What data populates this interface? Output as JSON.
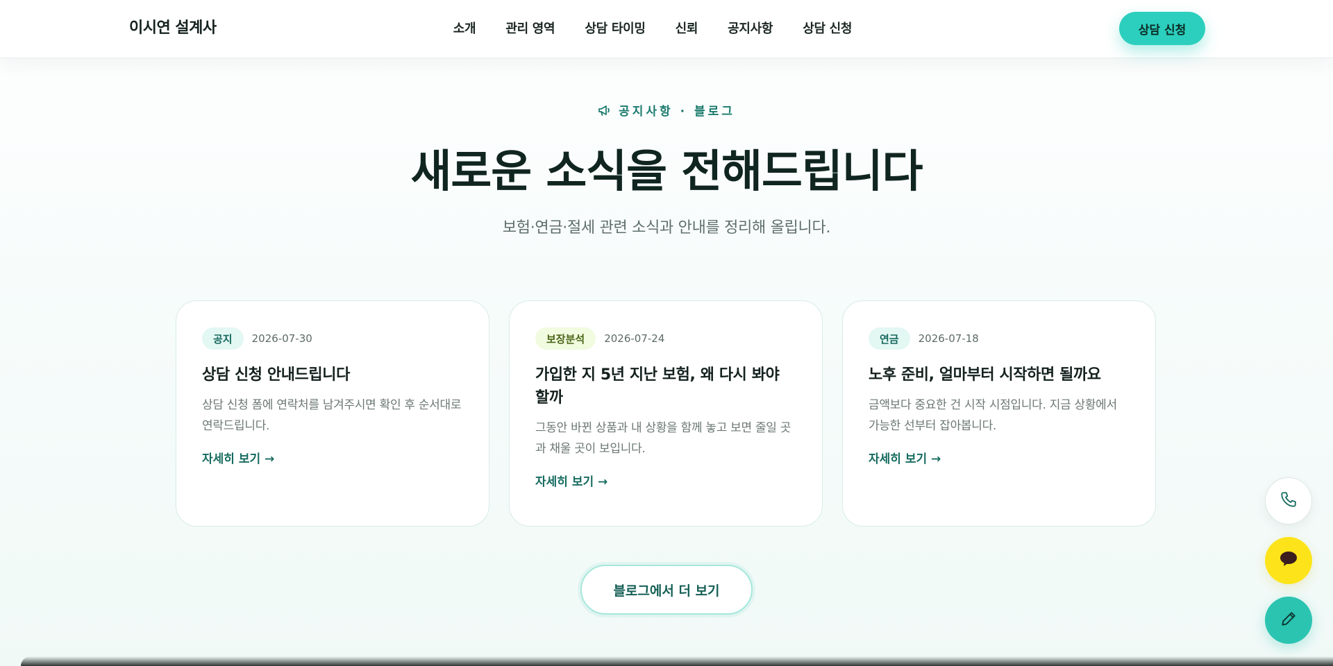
{
  "header": {
    "brand": "이시연 설계사",
    "nav": [
      "소개",
      "관리 영역",
      "상담 타이밍",
      "신뢰",
      "공지사항",
      "상담 신청"
    ],
    "cta_label": "상담 신청"
  },
  "section": {
    "eyebrow_icon": "megaphone-icon",
    "eyebrow": "공지사항 · 블로그",
    "title": "새로운 소식을 전해드립니다",
    "subtitle": "보험·연금·절세 관련 소식과 안내를 정리해 올립니다."
  },
  "posts": [
    {
      "tag": "공지",
      "tag_color": "#e3f7f3",
      "date": "2026-07-30",
      "title": "상담 신청 안내드립니다",
      "desc": "상담 신청 폼에 연락처를 남겨주시면 확인 후 순서대로 연락드립니다.",
      "link": "자세히 보기 →"
    },
    {
      "tag": "보장분석",
      "tag_color": "#f1fbdf",
      "date": "2026-07-24",
      "title": "가입한 지 5년 지난 보험, 왜 다시 봐야 할까",
      "desc": "그동안 바뀐 상품과 내 상황을 함께 놓고 보면 줄일 곳과 채울 곳이 보입니다.",
      "link": "자세히 보기 →"
    },
    {
      "tag": "연금",
      "tag_color": "#e3f7f3",
      "date": "2026-07-18",
      "title": "노후 준비, 얼마부터 시작하면 될까요",
      "desc": "금액보다 중요한 건 시작 시점입니다. 지금 상황에서 가능한 선부터 잡아봅니다.",
      "link": "자세히 보기 →"
    }
  ],
  "more_button": "블로그에서 더 보기",
  "floating": {
    "phone_icon": "phone-icon",
    "chat_icon": "chat-bubble-icon",
    "edit_icon": "pencil-icon",
    "chat_color": "#fde41a",
    "edit_color": "#2bc4b1"
  },
  "colors": {
    "accent": "#2ccfbd",
    "accent_dark": "#156b5f",
    "heading": "#10251f"
  }
}
